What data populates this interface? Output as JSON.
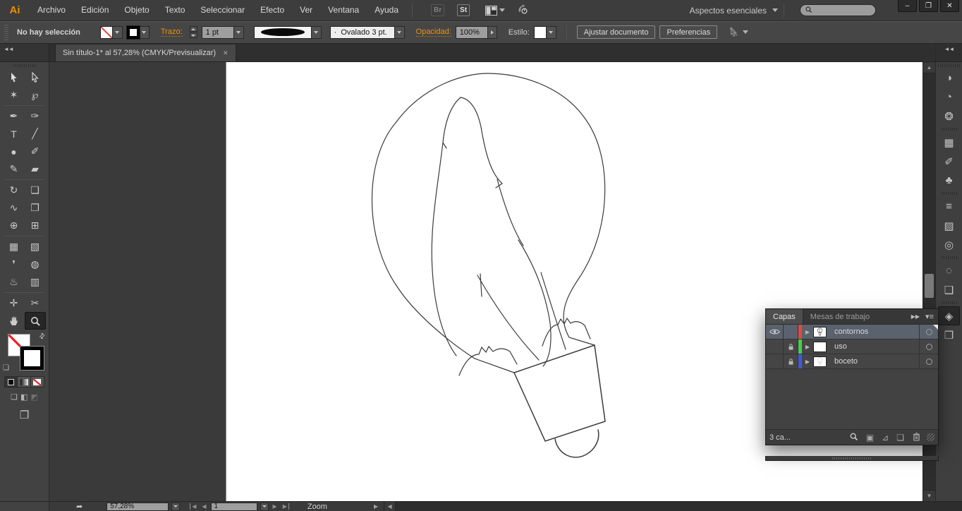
{
  "window": {
    "controls": [
      {
        "name": "minimize",
        "glyph": "–"
      },
      {
        "name": "restore",
        "glyph": "❐"
      },
      {
        "name": "close",
        "glyph": "✕"
      }
    ]
  },
  "menu_bar": {
    "logo": "Ai",
    "items": [
      "Archivo",
      "Edición",
      "Objeto",
      "Texto",
      "Seleccionar",
      "Efecto",
      "Ver",
      "Ventana",
      "Ayuda"
    ],
    "bridge_label": "Br",
    "stock_label": "St",
    "workspace_label": "Aspectos esenciales",
    "search_value": ""
  },
  "control_bar": {
    "selection_status": "No hay selección",
    "stroke_label": "Trazo:",
    "stroke_value": "1 pt",
    "brush_stroke_name": "Ovalado 3 pt.",
    "brush_dot": "·",
    "opacity_label": "Opacidad:",
    "opacity_value": "100%",
    "style_label": "Estilo:",
    "fit_document_label": "Ajustar documento",
    "preferences_label": "Preferencias"
  },
  "document_tab": {
    "title": "Sin título-1* al 57,28% (CMYK/Previsualizar)",
    "close_glyph": "✕"
  },
  "toolbar": {
    "active_tool": "zoom-tool",
    "separators_before_rows": [
      2,
      6,
      9,
      12
    ],
    "rows": [
      [
        {
          "name": "selection-tool",
          "glyph": "svg:arrow"
        },
        {
          "name": "direct-selection-tool",
          "glyph": "svg:arrow-o"
        }
      ],
      [
        {
          "name": "magic-wand-tool",
          "glyph": "✶"
        },
        {
          "name": "lasso-tool",
          "glyph": "℘"
        }
      ],
      [
        {
          "name": "pen-tool",
          "glyph": "✒"
        },
        {
          "name": "curvature-tool",
          "glyph": "✑"
        }
      ],
      [
        {
          "name": "type-tool",
          "glyph": "T"
        },
        {
          "name": "line-segment-tool",
          "glyph": "╱"
        }
      ],
      [
        {
          "name": "ellipse-tool",
          "glyph": "●"
        },
        {
          "name": "paintbrush-tool",
          "glyph": "✐"
        }
      ],
      [
        {
          "name": "pencil-tool",
          "glyph": "✎"
        },
        {
          "name": "eraser-tool",
          "glyph": "▰"
        }
      ],
      [
        {
          "name": "rotate-tool",
          "glyph": "↻"
        },
        {
          "name": "scale-tool",
          "glyph": "❏"
        }
      ],
      [
        {
          "name": "width-tool",
          "glyph": "∿"
        },
        {
          "name": "free-transform-tool",
          "glyph": "❐"
        }
      ],
      [
        {
          "name": "shape-builder-tool",
          "glyph": "⊕"
        },
        {
          "name": "perspective-grid-tool",
          "glyph": "⊞"
        }
      ],
      [
        {
          "name": "mesh-tool",
          "glyph": "▦"
        },
        {
          "name": "gradient-tool",
          "glyph": "▧"
        }
      ],
      [
        {
          "name": "eyedropper-tool",
          "glyph": "❜"
        },
        {
          "name": "blend-tool",
          "glyph": "◍"
        }
      ],
      [
        {
          "name": "symbol-sprayer-tool",
          "glyph": "♨"
        },
        {
          "name": "column-graph-tool",
          "glyph": "▥"
        }
      ],
      [
        {
          "name": "artboard-tool",
          "glyph": "✛"
        },
        {
          "name": "slice-tool",
          "glyph": "✂"
        }
      ],
      [
        {
          "name": "hand-tool",
          "glyph": "svg:hand"
        },
        {
          "name": "zoom-tool",
          "glyph": "svg:zoom"
        }
      ]
    ],
    "swap_glyph": "⇄",
    "default_swatches_glyph": "❏",
    "screen_mode_glyph": "❐",
    "drawing_modes": [
      {
        "name": "draw-normal",
        "glyph": "❏",
        "dim": false
      },
      {
        "name": "draw-behind",
        "glyph": "◧",
        "dim": false
      },
      {
        "name": "draw-inside",
        "glyph": "◩",
        "dim": true
      }
    ]
  },
  "dock": {
    "collapse_glyph": "◄◄",
    "expand_glyph": "◄◄",
    "active_icon": "layers-panel-icon",
    "groups": [
      [
        {
          "name": "color-panel-icon",
          "glyph": "◑"
        },
        {
          "name": "color-guide-panel-icon",
          "glyph": "◔"
        },
        {
          "name": "kuler-panel-icon",
          "glyph": "❂"
        }
      ],
      [
        {
          "name": "swatches-panel-icon",
          "glyph": "▦"
        },
        {
          "name": "brushes-panel-icon",
          "glyph": "✐"
        },
        {
          "name": "symbols-panel-icon",
          "glyph": "♣"
        }
      ],
      [
        {
          "name": "stroke-panel-icon",
          "glyph": "≡"
        },
        {
          "name": "gradient-panel-icon",
          "glyph": "▨"
        },
        {
          "name": "transparency-panel-icon",
          "glyph": "◎"
        }
      ],
      [
        {
          "name": "appearance-panel-icon",
          "glyph": "◌"
        },
        {
          "name": "graphic-styles-panel-icon",
          "glyph": "❑"
        }
      ],
      [
        {
          "name": "layers-panel-icon",
          "glyph": "◈"
        },
        {
          "name": "artboards-panel-icon",
          "glyph": "❒"
        }
      ]
    ]
  },
  "layers_panel": {
    "tabs": [
      {
        "label": "Capas",
        "active": true
      },
      {
        "label": "Mesas de trabajo",
        "active": false
      }
    ],
    "header_icons": {
      "collapse": "▶▶",
      "menu": "▾≡"
    },
    "layers": [
      {
        "name": "contornos",
        "color": "#e04a42",
        "visible": true,
        "locked": false,
        "selected": true,
        "thumb": "bulb"
      },
      {
        "name": "uso",
        "color": "#3fd43f",
        "visible": false,
        "locked": true,
        "selected": false,
        "thumb": "blank"
      },
      {
        "name": "boceto",
        "color": "#4656dd",
        "visible": false,
        "locked": true,
        "selected": false,
        "thumb": "faint"
      }
    ],
    "status_text": "3 ca...",
    "bottom_icons": [
      {
        "name": "locate-object-icon",
        "glyph": "svg:zoom"
      },
      {
        "name": "make-clipping-mask-icon",
        "glyph": "▣"
      },
      {
        "name": "new-sublayer-icon",
        "glyph": "⊿"
      },
      {
        "name": "new-layer-icon",
        "glyph": "❏"
      },
      {
        "name": "delete-layer-icon",
        "glyph": "svg:trash"
      }
    ]
  },
  "status_bar": {
    "export_icon": "➦",
    "zoom_value": "57,28%",
    "nav_first": "◀",
    "nav_prev": "◀",
    "nav_next": "▶",
    "nav_last": "▶",
    "artboard_value": "1",
    "tool_name": "Zoom",
    "right_arrow": "▶",
    "hscroll_left": "◀"
  },
  "canvas": {
    "description": "Pencil-style line drawing of a light bulb containing a bird, with small mountain zigzags at the bulb neck and a screw base with rounded tip"
  }
}
